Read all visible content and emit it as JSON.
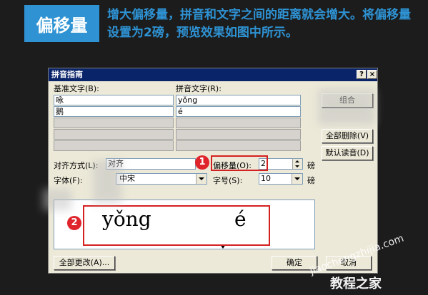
{
  "header": {
    "box_label": "偏移量",
    "description": "增大偏移量，拼音和文字之间的距离就会增大。将偏移量设置为2磅，预览效果如图中所示。"
  },
  "dialog": {
    "title": "拼音指南",
    "help_btn": "?",
    "close_btn": "×",
    "base_text_label": "基准文字(B):",
    "ruby_text_label": "拼音文字(R):",
    "rows": [
      {
        "base": "咏",
        "ruby": "yǒng"
      },
      {
        "base": "鹅",
        "ruby": "é"
      },
      {
        "base": "",
        "ruby": ""
      },
      {
        "base": "",
        "ruby": ""
      },
      {
        "base": "",
        "ruby": ""
      }
    ],
    "buttons": {
      "combine": "组合",
      "clear_all": "全部删除(V)",
      "default_reading": "默认读音(D)",
      "change_all": "全部更改(A)...",
      "ok": "确定",
      "cancel": "取消"
    },
    "alignment_label": "对齐方式(L):",
    "alignment_value": "对齐",
    "offset_label": "偏移量(O):",
    "offset_value": "2",
    "offset_unit": "磅",
    "font_label": "字体(F):",
    "font_value": "中宋",
    "size_label": "字号(S):",
    "size_value": "10",
    "size_unit": "磅",
    "preview": {
      "word1": "yǒng",
      "word2": "é"
    }
  },
  "badges": {
    "one": "1",
    "two": "2"
  },
  "watermark": {
    "url": "jiaochengzhijia.com",
    "name": "教程之家"
  },
  "colors": {
    "accent": "#2e92d3",
    "highlight": "#d42020"
  }
}
